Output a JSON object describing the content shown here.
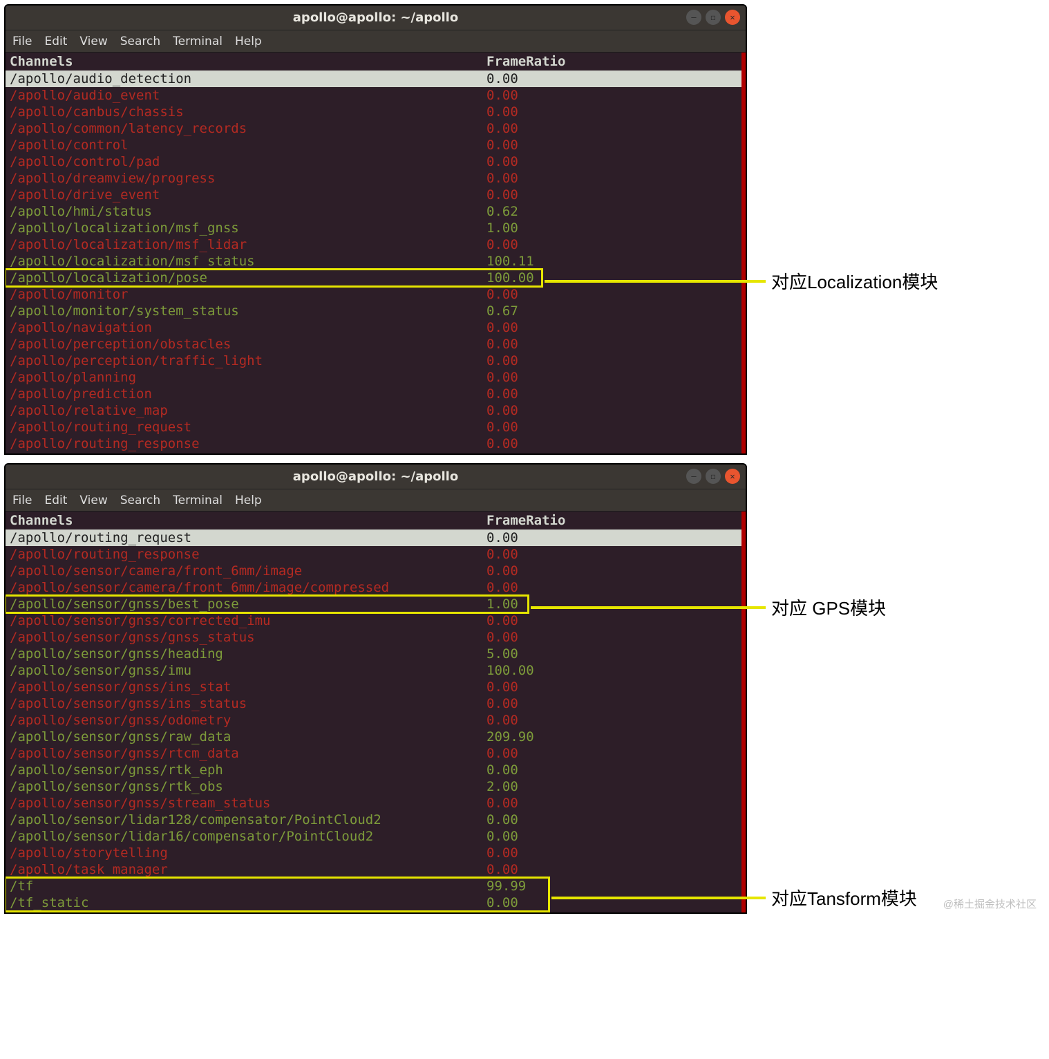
{
  "watermark": "@稀土掘金技术社区",
  "annotations": {
    "loc": "对应Localization模块",
    "gps": "对应 GPS模块",
    "tf": "对应Tansform模块"
  },
  "windows": [
    {
      "title": "apollo@apollo: ~/apollo",
      "menu": [
        "File",
        "Edit",
        "View",
        "Search",
        "Terminal",
        "Help"
      ],
      "header": {
        "channel": "Channels",
        "ratio": "FrameRatio"
      },
      "rows": [
        {
          "cls": "white",
          "channel": "/apollo/audio_detection",
          "ratio": "0.00"
        },
        {
          "cls": "red",
          "channel": "/apollo/audio_event",
          "ratio": "0.00"
        },
        {
          "cls": "red",
          "channel": "/apollo/canbus/chassis",
          "ratio": "0.00"
        },
        {
          "cls": "red",
          "channel": "/apollo/common/latency_records",
          "ratio": "0.00"
        },
        {
          "cls": "red",
          "channel": "/apollo/control",
          "ratio": "0.00"
        },
        {
          "cls": "red",
          "channel": "/apollo/control/pad",
          "ratio": "0.00"
        },
        {
          "cls": "red",
          "channel": "/apollo/dreamview/progress",
          "ratio": "0.00"
        },
        {
          "cls": "red",
          "channel": "/apollo/drive_event",
          "ratio": "0.00"
        },
        {
          "cls": "green",
          "channel": "/apollo/hmi/status",
          "ratio": "0.62"
        },
        {
          "cls": "green",
          "channel": "/apollo/localization/msf_gnss",
          "ratio": "1.00"
        },
        {
          "cls": "red",
          "channel": "/apollo/localization/msf_lidar",
          "ratio": "0.00"
        },
        {
          "cls": "green",
          "channel": "/apollo/localization/msf_status",
          "ratio": "100.11"
        },
        {
          "cls": "green",
          "channel": "/apollo/localization/pose",
          "ratio": "100.00"
        },
        {
          "cls": "red",
          "channel": "/apollo/monitor",
          "ratio": "0.00"
        },
        {
          "cls": "green",
          "channel": "/apollo/monitor/system_status",
          "ratio": "0.67"
        },
        {
          "cls": "red",
          "channel": "/apollo/navigation",
          "ratio": "0.00"
        },
        {
          "cls": "red",
          "channel": "/apollo/perception/obstacles",
          "ratio": "0.00"
        },
        {
          "cls": "red",
          "channel": "/apollo/perception/traffic_light",
          "ratio": "0.00"
        },
        {
          "cls": "red",
          "channel": "/apollo/planning",
          "ratio": "0.00"
        },
        {
          "cls": "red",
          "channel": "/apollo/prediction",
          "ratio": "0.00"
        },
        {
          "cls": "red",
          "channel": "/apollo/relative_map",
          "ratio": "0.00"
        },
        {
          "cls": "red",
          "channel": "/apollo/routing_request",
          "ratio": "0.00"
        },
        {
          "cls": "red",
          "channel": "/apollo/routing_response",
          "ratio": "0.00"
        }
      ]
    },
    {
      "title": "apollo@apollo: ~/apollo",
      "menu": [
        "File",
        "Edit",
        "View",
        "Search",
        "Terminal",
        "Help"
      ],
      "header": {
        "channel": "Channels",
        "ratio": "FrameRatio"
      },
      "rows": [
        {
          "cls": "white",
          "channel": "/apollo/routing_request",
          "ratio": "0.00"
        },
        {
          "cls": "red",
          "channel": "/apollo/routing_response",
          "ratio": "0.00"
        },
        {
          "cls": "red",
          "channel": "/apollo/sensor/camera/front_6mm/image",
          "ratio": "0.00"
        },
        {
          "cls": "red",
          "channel": "/apollo/sensor/camera/front_6mm/image/compressed",
          "ratio": "0.00"
        },
        {
          "cls": "green",
          "channel": "/apollo/sensor/gnss/best_pose",
          "ratio": "1.00"
        },
        {
          "cls": "red",
          "channel": "/apollo/sensor/gnss/corrected_imu",
          "ratio": "0.00"
        },
        {
          "cls": "red",
          "channel": "/apollo/sensor/gnss/gnss_status",
          "ratio": "0.00"
        },
        {
          "cls": "green",
          "channel": "/apollo/sensor/gnss/heading",
          "ratio": "5.00"
        },
        {
          "cls": "green",
          "channel": "/apollo/sensor/gnss/imu",
          "ratio": "100.00"
        },
        {
          "cls": "red",
          "channel": "/apollo/sensor/gnss/ins_stat",
          "ratio": "0.00"
        },
        {
          "cls": "red",
          "channel": "/apollo/sensor/gnss/ins_status",
          "ratio": "0.00"
        },
        {
          "cls": "red",
          "channel": "/apollo/sensor/gnss/odometry",
          "ratio": "0.00"
        },
        {
          "cls": "green",
          "channel": "/apollo/sensor/gnss/raw_data",
          "ratio": "209.90"
        },
        {
          "cls": "red",
          "channel": "/apollo/sensor/gnss/rtcm_data",
          "ratio": "0.00"
        },
        {
          "cls": "green",
          "channel": "/apollo/sensor/gnss/rtk_eph",
          "ratio": "0.00"
        },
        {
          "cls": "green",
          "channel": "/apollo/sensor/gnss/rtk_obs",
          "ratio": "2.00"
        },
        {
          "cls": "red",
          "channel": "/apollo/sensor/gnss/stream_status",
          "ratio": "0.00"
        },
        {
          "cls": "green",
          "channel": "/apollo/sensor/lidar128/compensator/PointCloud2",
          "ratio": "0.00"
        },
        {
          "cls": "green",
          "channel": "/apollo/sensor/lidar16/compensator/PointCloud2",
          "ratio": "0.00"
        },
        {
          "cls": "red",
          "channel": "/apollo/storytelling",
          "ratio": "0.00"
        },
        {
          "cls": "red",
          "channel": "/apollo/task_manager",
          "ratio": "0.00"
        },
        {
          "cls": "green",
          "channel": "/tf",
          "ratio": "99.99"
        },
        {
          "cls": "green",
          "channel": "/tf_static",
          "ratio": "0.00"
        }
      ]
    }
  ]
}
